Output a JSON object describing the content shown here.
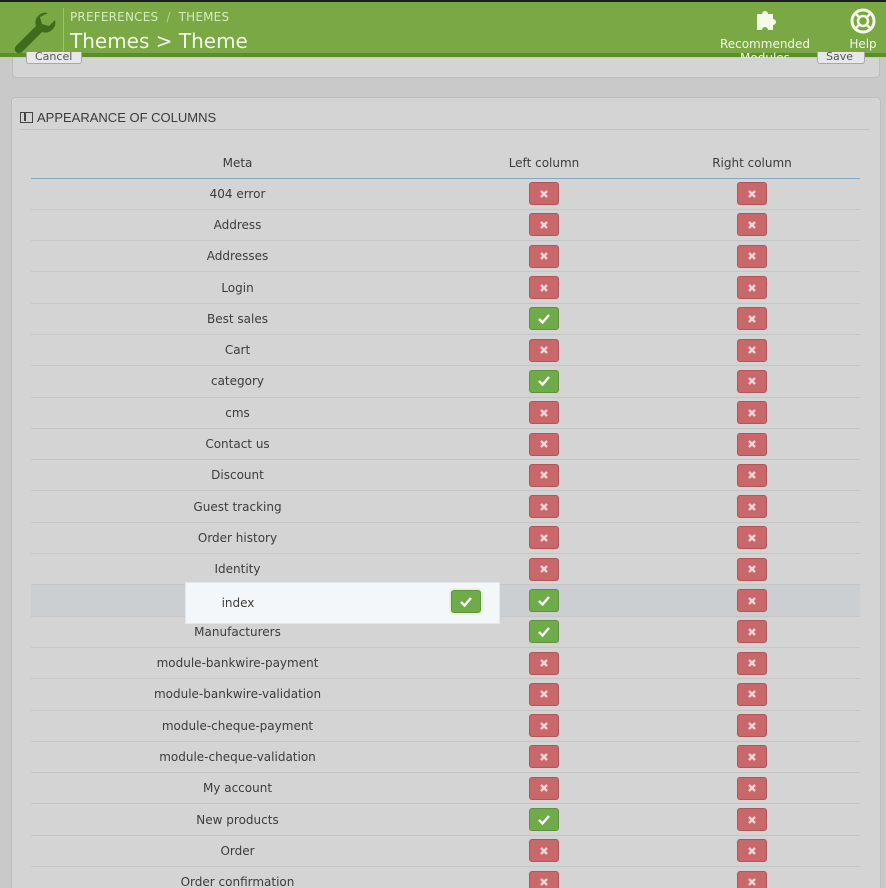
{
  "header": {
    "breadcrumb": [
      "PREFERENCES",
      "THEMES"
    ],
    "breadcrumb_separator": "/",
    "title": "Themes > Theme",
    "recommended_modules_label": "Recommended Modules",
    "help_label": "Help",
    "accent_color": "#79a845"
  },
  "top_panel": {
    "cancel_label": "Cancel",
    "save_label": "Save"
  },
  "panel": {
    "title": "APPEARANCE OF COLUMNS",
    "columns": [
      "Meta",
      "Left column",
      "Right column"
    ],
    "rows": [
      {
        "meta": "404 error",
        "left": false,
        "right": false
      },
      {
        "meta": "Address",
        "left": false,
        "right": false
      },
      {
        "meta": "Addresses",
        "left": false,
        "right": false
      },
      {
        "meta": "Login",
        "left": false,
        "right": false
      },
      {
        "meta": "Best sales",
        "left": true,
        "right": false
      },
      {
        "meta": "Cart",
        "left": false,
        "right": false
      },
      {
        "meta": "category",
        "left": true,
        "right": false
      },
      {
        "meta": "cms",
        "left": false,
        "right": false
      },
      {
        "meta": "Contact us",
        "left": false,
        "right": false
      },
      {
        "meta": "Discount",
        "left": false,
        "right": false
      },
      {
        "meta": "Guest tracking",
        "left": false,
        "right": false
      },
      {
        "meta": "Order history",
        "left": false,
        "right": false
      },
      {
        "meta": "Identity",
        "left": false,
        "right": false
      },
      {
        "meta": "index",
        "left": true,
        "right": false,
        "highlighted": true
      },
      {
        "meta": "Manufacturers",
        "left": true,
        "right": false
      },
      {
        "meta": "module-bankwire-payment",
        "left": false,
        "right": false
      },
      {
        "meta": "module-bankwire-validation",
        "left": false,
        "right": false
      },
      {
        "meta": "module-cheque-payment",
        "left": false,
        "right": false
      },
      {
        "meta": "module-cheque-validation",
        "left": false,
        "right": false
      },
      {
        "meta": "My account",
        "left": false,
        "right": false
      },
      {
        "meta": "New products",
        "left": true,
        "right": false
      },
      {
        "meta": "Order",
        "left": false,
        "right": false
      },
      {
        "meta": "Order confirmation",
        "left": false,
        "right": false
      }
    ]
  },
  "icons": {
    "logo": "wrench-icon",
    "modules": "puzzle-icon",
    "help": "lifebuoy-icon",
    "enabled": "check-icon",
    "disabled": "cross-icon"
  },
  "colors": {
    "enabled": "#6fab49",
    "disabled": "#c9686a"
  }
}
